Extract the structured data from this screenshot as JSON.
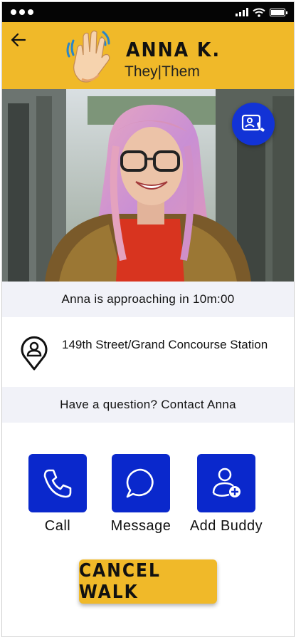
{
  "header": {
    "name": "ANNA K.",
    "pronouns": "They|Them",
    "back_icon": "arrow-left-icon",
    "avatar_icon": "waving-hand-icon"
  },
  "status_bar": {
    "icons": [
      "signal-icon",
      "wifi-icon",
      "battery-icon"
    ]
  },
  "photo": {
    "description_icon": "profile-photo",
    "video_call_icon": "video-call-icon"
  },
  "approach": {
    "text": "Anna is approaching in 10m:00"
  },
  "location": {
    "icon": "location-pin-person-icon",
    "text": "149th Street/Grand Concourse Station"
  },
  "contact": {
    "text": "Have a question? Contact Anna"
  },
  "actions": [
    {
      "label": "Call",
      "icon": "phone-icon"
    },
    {
      "label": "Message",
      "icon": "chat-bubble-icon"
    },
    {
      "label": "Add Buddy",
      "icon": "add-user-icon"
    }
  ],
  "cancel_button": {
    "label": "CANCEL WALK"
  },
  "colors": {
    "accent_yellow": "#F0B929",
    "primary_blue": "#0A28CC",
    "band_gray": "#F1F2F8"
  }
}
